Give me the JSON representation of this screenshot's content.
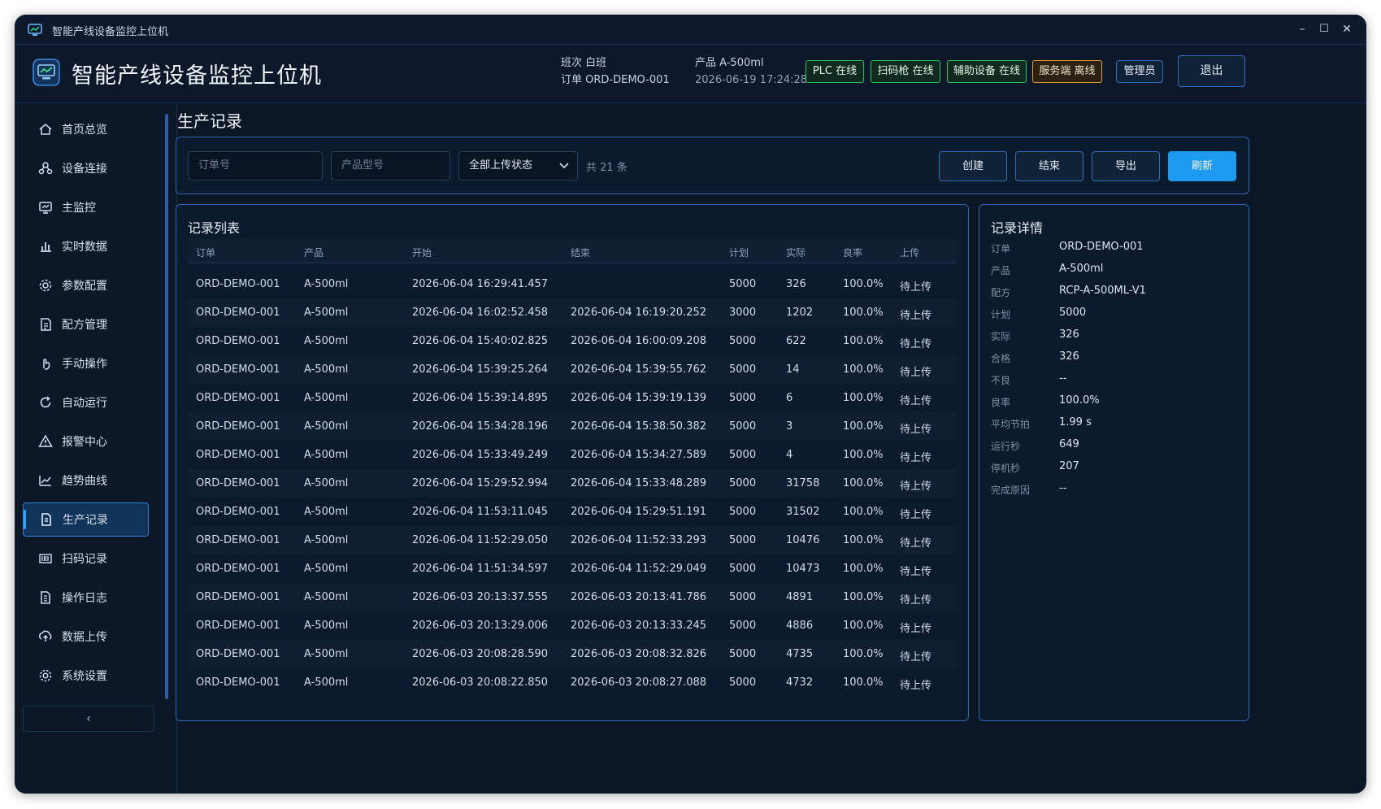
{
  "window": {
    "title": "智能产线设备监控上位机",
    "minimize": "–",
    "maximize": "☐",
    "close": "✕"
  },
  "header": {
    "title": "智能产线设备监控上位机",
    "shift_label": "班次 白班",
    "order_label": "订单 ORD-DEMO-001",
    "product_label": "产品 A-500ml",
    "datetime": "2026-06-19 17:24:28",
    "status": [
      {
        "label": "PLC 在线",
        "state": "online"
      },
      {
        "label": "扫码枪 在线",
        "state": "online"
      },
      {
        "label": "辅助设备 在线",
        "state": "online"
      },
      {
        "label": "服务端 离线",
        "state": "offline"
      }
    ],
    "user_button": "管理员",
    "logout_button": "退出"
  },
  "sidebar": {
    "items": [
      {
        "label": "首页总览",
        "icon": "home-icon"
      },
      {
        "label": "设备连接",
        "icon": "network-icon"
      },
      {
        "label": "主监控",
        "icon": "monitor-icon"
      },
      {
        "label": "实时数据",
        "icon": "bar-chart-icon"
      },
      {
        "label": "参数配置",
        "icon": "gear-icon"
      },
      {
        "label": "配方管理",
        "icon": "recipe-icon"
      },
      {
        "label": "手动操作",
        "icon": "hand-icon"
      },
      {
        "label": "自动运行",
        "icon": "refresh-icon"
      },
      {
        "label": "报警中心",
        "icon": "warning-icon"
      },
      {
        "label": "趋势曲线",
        "icon": "line-chart-icon"
      },
      {
        "label": "生产记录",
        "icon": "document-icon",
        "active": true
      },
      {
        "label": "扫码记录",
        "icon": "barcode-icon"
      },
      {
        "label": "操作日志",
        "icon": "log-icon"
      },
      {
        "label": "数据上传",
        "icon": "upload-icon"
      },
      {
        "label": "系统设置",
        "icon": "settings-icon"
      }
    ],
    "collapse": "‹"
  },
  "page": {
    "title": "生产记录",
    "filters": {
      "order_placeholder": "订单号",
      "product_placeholder": "产品型号",
      "upload_status": "全部上传状态",
      "count": "共 21 条"
    },
    "buttons": {
      "create": "创建",
      "finish": "结束",
      "export": "导出",
      "refresh": "刷新"
    }
  },
  "records": {
    "title": "记录列表",
    "columns": [
      "订单",
      "产品",
      "开始",
      "结束",
      "计划",
      "实际",
      "良率",
      "上传"
    ],
    "rows": [
      [
        "ORD-DEMO-001",
        "A-500ml",
        "2026-06-04 16:29:41.457",
        "",
        "5000",
        "326",
        "100.0%",
        "待上传"
      ],
      [
        "ORD-DEMO-001",
        "A-500ml",
        "2026-06-04 16:02:52.458",
        "2026-06-04 16:19:20.252",
        "3000",
        "1202",
        "100.0%",
        "待上传"
      ],
      [
        "ORD-DEMO-001",
        "A-500ml",
        "2026-06-04 15:40:02.825",
        "2026-06-04 16:00:09.208",
        "5000",
        "622",
        "100.0%",
        "待上传"
      ],
      [
        "ORD-DEMO-001",
        "A-500ml",
        "2026-06-04 15:39:25.264",
        "2026-06-04 15:39:55.762",
        "5000",
        "14",
        "100.0%",
        "待上传"
      ],
      [
        "ORD-DEMO-001",
        "A-500ml",
        "2026-06-04 15:39:14.895",
        "2026-06-04 15:39:19.139",
        "5000",
        "6",
        "100.0%",
        "待上传"
      ],
      [
        "ORD-DEMO-001",
        "A-500ml",
        "2026-06-04 15:34:28.196",
        "2026-06-04 15:38:50.382",
        "5000",
        "3",
        "100.0%",
        "待上传"
      ],
      [
        "ORD-DEMO-001",
        "A-500ml",
        "2026-06-04 15:33:49.249",
        "2026-06-04 15:34:27.589",
        "5000",
        "4",
        "100.0%",
        "待上传"
      ],
      [
        "ORD-DEMO-001",
        "A-500ml",
        "2026-06-04 15:29:52.994",
        "2026-06-04 15:33:48.289",
        "5000",
        "31758",
        "100.0%",
        "待上传"
      ],
      [
        "ORD-DEMO-001",
        "A-500ml",
        "2026-06-04 11:53:11.045",
        "2026-06-04 15:29:51.191",
        "5000",
        "31502",
        "100.0%",
        "待上传"
      ],
      [
        "ORD-DEMO-001",
        "A-500ml",
        "2026-06-04 11:52:29.050",
        "2026-06-04 11:52:33.293",
        "5000",
        "10476",
        "100.0%",
        "待上传"
      ],
      [
        "ORD-DEMO-001",
        "A-500ml",
        "2026-06-04 11:51:34.597",
        "2026-06-04 11:52:29.049",
        "5000",
        "10473",
        "100.0%",
        "待上传"
      ],
      [
        "ORD-DEMO-001",
        "A-500ml",
        "2026-06-03 20:13:37.555",
        "2026-06-03 20:13:41.786",
        "5000",
        "4891",
        "100.0%",
        "待上传"
      ],
      [
        "ORD-DEMO-001",
        "A-500ml",
        "2026-06-03 20:13:29.006",
        "2026-06-03 20:13:33.245",
        "5000",
        "4886",
        "100.0%",
        "待上传"
      ],
      [
        "ORD-DEMO-001",
        "A-500ml",
        "2026-06-03 20:08:28.590",
        "2026-06-03 20:08:32.826",
        "5000",
        "4735",
        "100.0%",
        "待上传"
      ],
      [
        "ORD-DEMO-001",
        "A-500ml",
        "2026-06-03 20:08:22.850",
        "2026-06-03 20:08:27.088",
        "5000",
        "4732",
        "100.0%",
        "待上传"
      ]
    ]
  },
  "detail": {
    "title": "记录详情",
    "fields": [
      {
        "key": "订单",
        "value": "ORD-DEMO-001"
      },
      {
        "key": "产品",
        "value": "A-500ml"
      },
      {
        "key": "配方",
        "value": "RCP-A-500ML-V1"
      },
      {
        "key": "计划",
        "value": "5000"
      },
      {
        "key": "实际",
        "value": "326"
      },
      {
        "key": "合格",
        "value": "326"
      },
      {
        "key": "不良",
        "value": "--"
      },
      {
        "key": "良率",
        "value": "100.0%"
      },
      {
        "key": "平均节拍",
        "value": "1.99 s"
      },
      {
        "key": "运行秒",
        "value": "649"
      },
      {
        "key": "停机秒",
        "value": "207"
      },
      {
        "key": "完成原因",
        "value": "--"
      }
    ]
  },
  "colors": {
    "accent": "#1d9bf0",
    "online": "#2fbf5a",
    "offline": "#d9a03a",
    "border": "#2c67ad"
  }
}
